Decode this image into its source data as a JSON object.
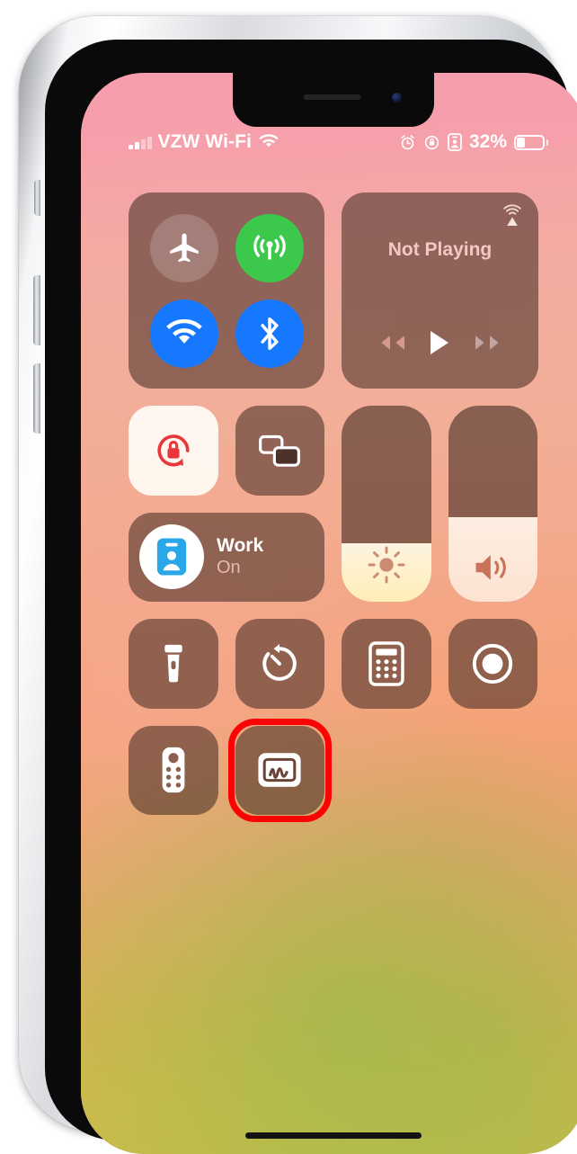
{
  "device": {
    "name": "iphone-with-notch",
    "home_indicator": "home-indicator"
  },
  "status_bar": {
    "signal_bars_filled": 2,
    "signal_bars_total": 4,
    "carrier": "VZW Wi-Fi",
    "wifi_icon": "wifi-icon",
    "alarm_icon": "alarm-clock-icon",
    "rotation_lock_icon": "rotation-lock-icon",
    "focus_icon": "focus-work-badge-icon",
    "battery_percent": "32%",
    "battery_level": 32
  },
  "control_center": {
    "connectivity": {
      "label": "connectivity-module",
      "buttons": [
        {
          "name": "airplane-mode-button",
          "icon": "airplane-icon",
          "state": "off",
          "color": "#6b4a41"
        },
        {
          "name": "cellular-data-button",
          "icon": "cellular-icon",
          "state": "on",
          "color": "#3cc84a"
        },
        {
          "name": "wifi-button",
          "icon": "wifi-icon",
          "state": "on",
          "color": "#1678ff"
        },
        {
          "name": "bluetooth-button",
          "icon": "bluetooth-icon",
          "state": "on",
          "color": "#1678ff"
        }
      ]
    },
    "media": {
      "title": "Not Playing",
      "airplay_icon": "airplay-icon",
      "controls": [
        {
          "name": "rewind-button",
          "icon": "rewind-icon"
        },
        {
          "name": "play-button",
          "icon": "play-icon"
        },
        {
          "name": "forward-button",
          "icon": "forward-icon"
        }
      ]
    },
    "rotation_lock": {
      "name": "rotation-lock-tile",
      "icon": "rotation-lock-icon",
      "state": "on",
      "color": "#e8373c"
    },
    "screen_mirroring": {
      "name": "screen-mirroring-tile",
      "icon": "screen-mirroring-icon",
      "state": "off"
    },
    "focus": {
      "name": "Work",
      "state": "On",
      "icon": "focus-work-badge-icon"
    },
    "brightness": {
      "name": "brightness-slider",
      "icon": "brightness-sun-icon",
      "value": 30
    },
    "volume": {
      "name": "volume-slider",
      "icon": "volume-speaker-icon",
      "value": 43
    },
    "tiles": [
      {
        "name": "flashlight-tile",
        "icon": "flashlight-icon"
      },
      {
        "name": "timer-tile",
        "icon": "timer-icon"
      },
      {
        "name": "calculator-tile",
        "icon": "calculator-icon"
      },
      {
        "name": "screen-record-tile",
        "icon": "screen-record-icon"
      },
      {
        "name": "apple-tv-remote-tile",
        "icon": "tv-remote-icon"
      },
      {
        "name": "quick-note-tile",
        "icon": "quick-note-icon",
        "highlighted": true
      }
    ]
  },
  "annotation": {
    "highlight_color": "#fb0204",
    "highlight_target": "quick-note-tile"
  }
}
